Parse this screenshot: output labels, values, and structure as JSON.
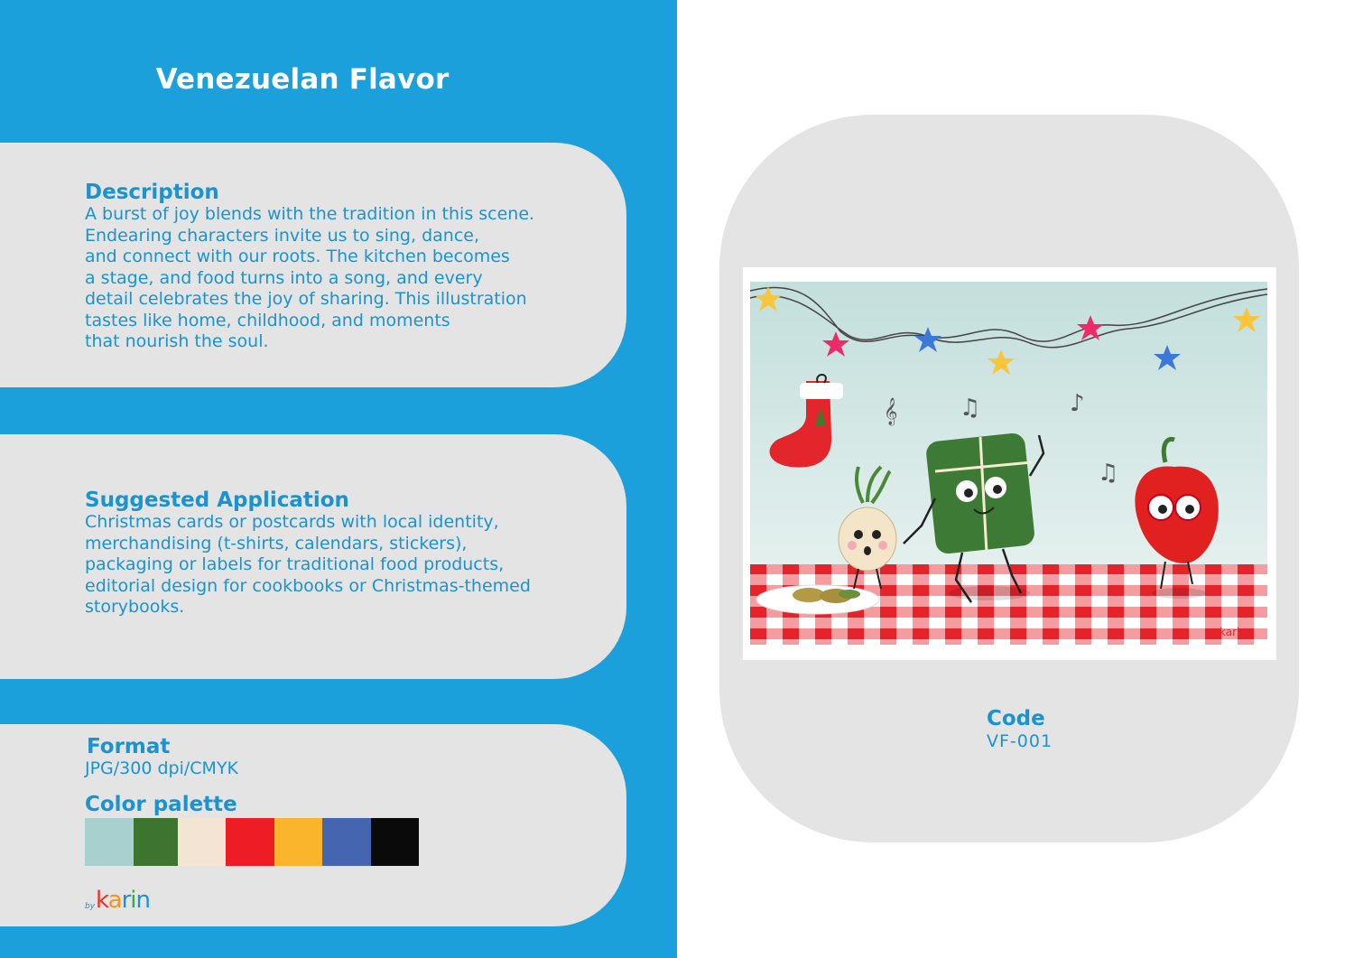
{
  "title": "Venezuelan Flavor",
  "description": {
    "heading": "Description",
    "text": "A burst of joy blends with the tradition in this scene.\nEndearing characters invite us to sing, dance,\nand connect with our roots. The kitchen becomes\na stage, and food turns into a song, and every\ndetail celebrates the joy of sharing. This illustration\ntastes like home, childhood, and moments\nthat nourish the soul."
  },
  "application": {
    "heading": "Suggested Application",
    "text": "Christmas cards or postcards with local identity,\nmerchandising (t-shirts, calendars, stickers),\npackaging or labels for traditional food products,\neditorial design for cookbooks or Christmas-themed\nstorybooks."
  },
  "format": {
    "heading": "Format",
    "value": "JPG/300 dpi/CMYK"
  },
  "palette": {
    "heading": "Color palette",
    "colors": [
      "#a8d0cf",
      "#3d7530",
      "#f3e4d3",
      "#ee1c25",
      "#fbb52c",
      "#4565b0",
      "#0a0a0a"
    ]
  },
  "logo": {
    "by": "by",
    "word": "karin",
    "letter_colors": [
      "#ee3124",
      "#f7941d",
      "#1a93cf",
      "#3aa84a",
      "#1a93cf"
    ]
  },
  "code": {
    "label": "Code",
    "value": "VF-001"
  },
  "illustration": {
    "signature": "karin",
    "colors": {
      "wall": "#cfe6e4",
      "tablecloth_red": "#e8232b",
      "pepper": "#e0211f",
      "hallaca": "#3d7a35",
      "stocking": "#e3262b",
      "star_pink": "#ee2b67",
      "star_blue": "#3c78d8",
      "star_yellow": "#f9c53b"
    }
  }
}
